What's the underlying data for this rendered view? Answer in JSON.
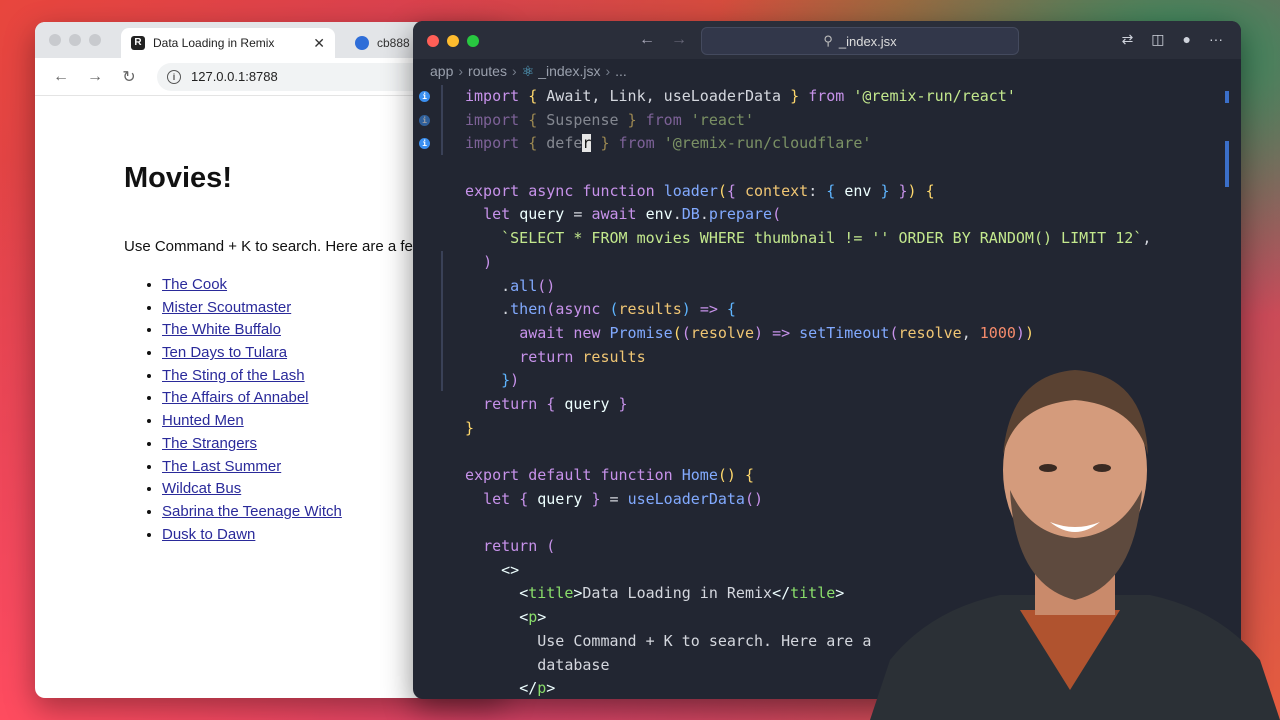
{
  "browser": {
    "active_tab": "Data Loading in Remix",
    "inactive_tab": "cb888",
    "url": "127.0.0.1:8788",
    "page_title": "Movies!",
    "intro": "Use Command + K to search. Here are a fe",
    "movies": [
      "The Cook",
      "Mister Scoutmaster",
      "The White Buffalo",
      "Ten Days to Tulara",
      "The Sting of the Lash",
      "The Affairs of Annabel",
      "Hunted Men",
      "The Strangers",
      "The Last Summer",
      "Wildcat Bus",
      "Sabrina the Teenage Witch",
      "Dusk to Dawn"
    ]
  },
  "editor": {
    "command_center": "_index.jsx",
    "breadcrumbs": [
      "app",
      "routes",
      "_index.jsx",
      "..."
    ],
    "lines": [
      "import { Await, Link, useLoaderData } from '@remix-run/react'",
      "import { Suspense } from 'react'",
      "import { defer } from '@remix-run/cloudflare'",
      "",
      "export async function loader({ context: { env } }) {",
      "  let query = await env.DB.prepare(",
      "    `SELECT * FROM movies WHERE thumbnail != '' ORDER BY RANDOM() LIMIT 12`,",
      "  )",
      "    .all()",
      "    .then(async (results) => {",
      "      await new Promise((resolve) => setTimeout(resolve, 1000))",
      "      return results",
      "    })",
      "  return { query }",
      "}",
      "",
      "export default function Home() {",
      "  let { query } = useLoaderData()",
      "",
      "  return (",
      "    <>",
      "      <title>Data Loading in Remix</title>",
      "      <p>",
      "        Use Command + K to search. Here are a",
      "        database",
      "      </p>"
    ]
  },
  "icons": {
    "back": "arrow-left-icon",
    "forward": "arrow-right-icon",
    "reload": "reload-icon",
    "search": "search-icon"
  }
}
